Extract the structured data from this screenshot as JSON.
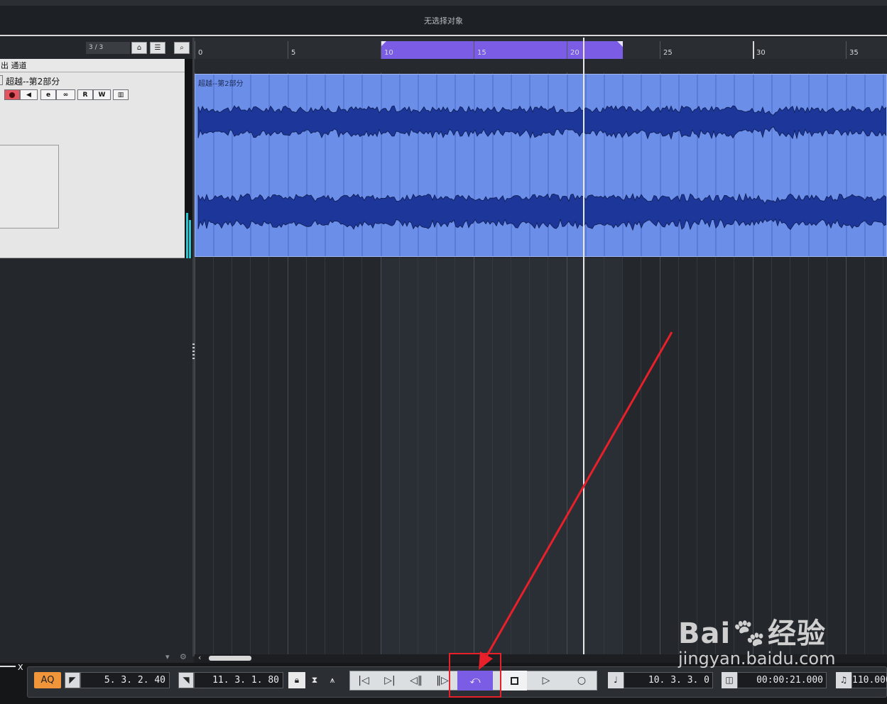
{
  "info_line": {
    "text": "无选择对象"
  },
  "track_list": {
    "count": "3 / 3",
    "channel_label": "出 通道",
    "track_name": "超越--第2部分",
    "buttons": {
      "read": "R",
      "write": "W"
    }
  },
  "ruler": {
    "labels": [
      "0",
      "5",
      "10",
      "15",
      "20",
      "25",
      "30",
      "35"
    ]
  },
  "clip": {
    "name": "超越--第2部分"
  },
  "transport": {
    "aq_label": "AQ",
    "left_locator": "5. 3. 2. 40",
    "right_locator": "11. 3. 1. 80",
    "position_bars": "10. 3. 3.   0",
    "position_time": "00:00:21.000",
    "tempo": "110.000"
  },
  "watermark": {
    "brand": "Bai",
    "brand_cn": "经验",
    "url": "jingyan.baidu.com"
  }
}
